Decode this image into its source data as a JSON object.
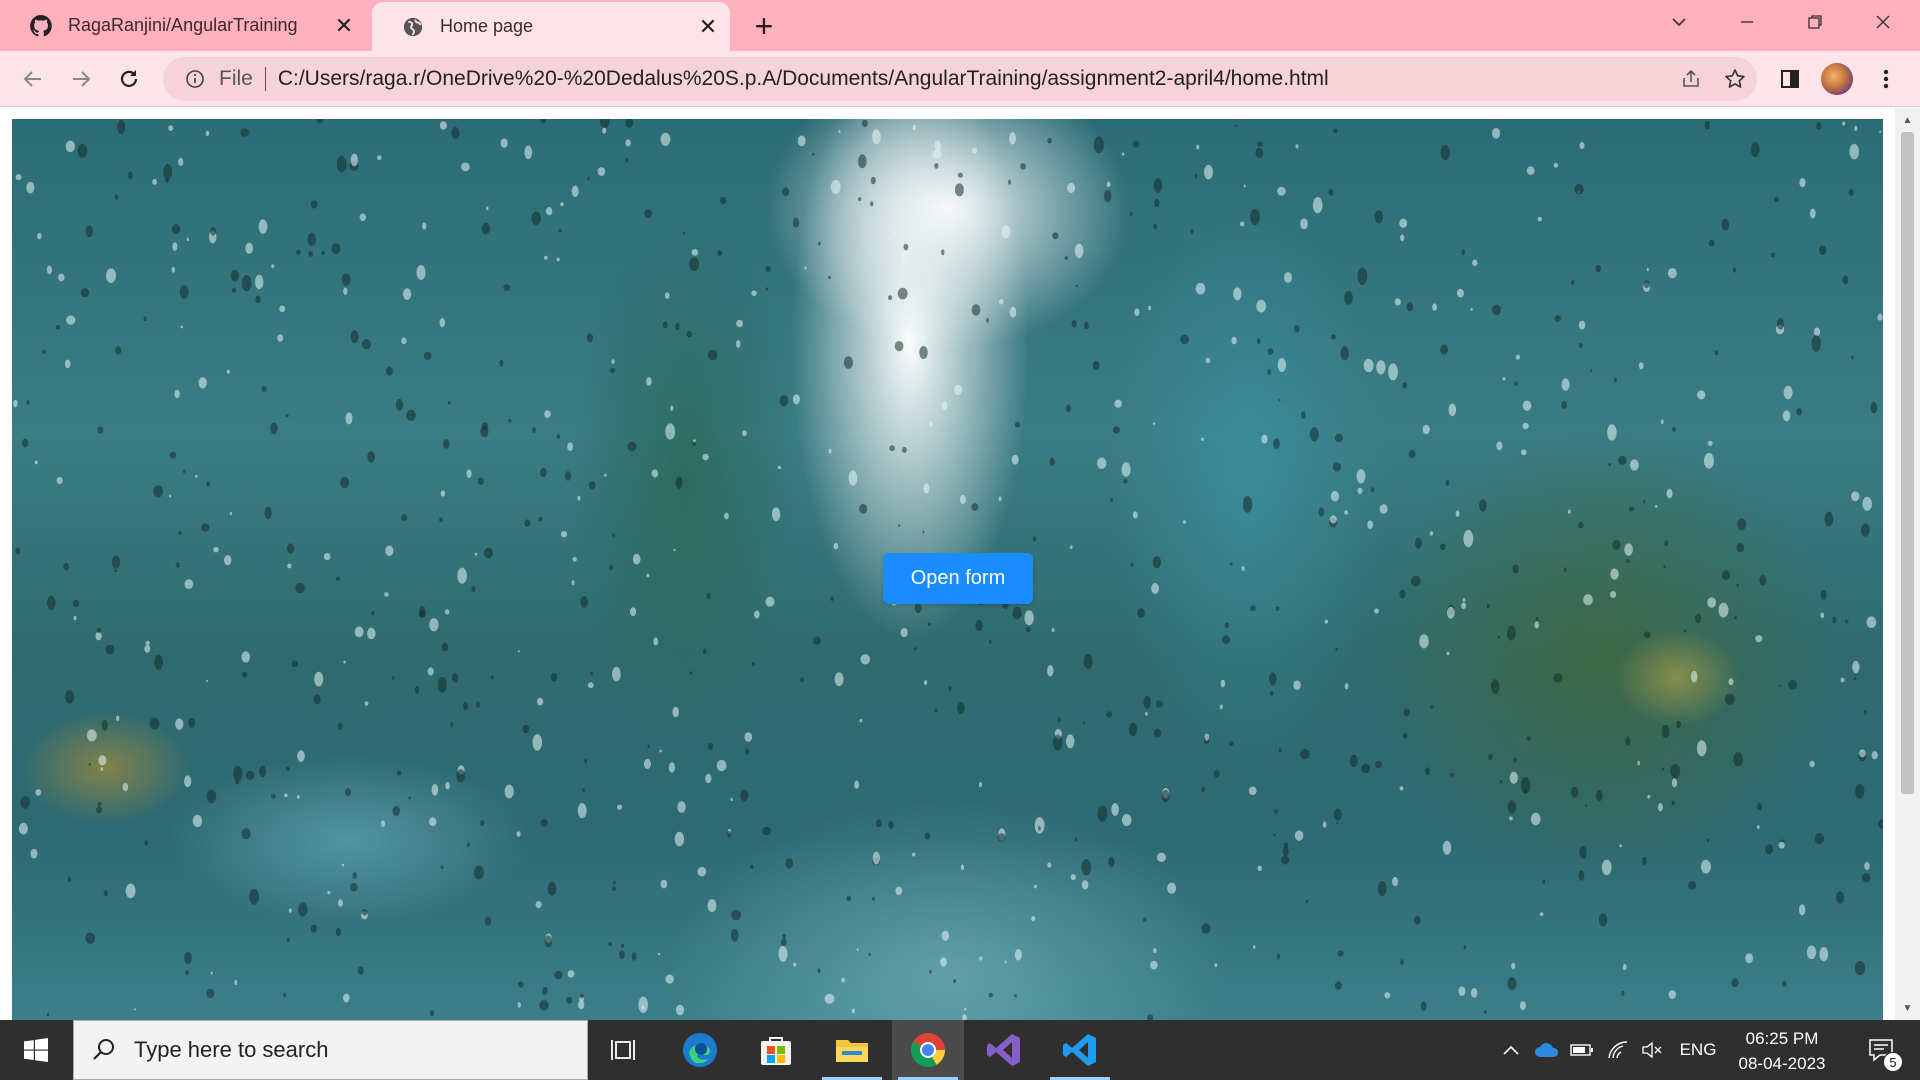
{
  "browser": {
    "tabs": [
      {
        "title": "RagaRanjini/AngularTraining",
        "icon": "github-icon",
        "active": false
      },
      {
        "title": "Home page",
        "icon": "globe-icon",
        "active": true
      }
    ],
    "omnibox": {
      "scheme_label": "File",
      "url": "C:/Users/raga.r/OneDrive%20-%20Dedalus%20S.p.A/Documents/AngularTraining/assignment2-april4/home.html"
    }
  },
  "page": {
    "open_form_label": "Open form",
    "accent_color": "#1a8cff"
  },
  "taskbar": {
    "search_placeholder": "Type here to search",
    "language": "ENG",
    "time": "06:25 PM",
    "date": "08-04-2023",
    "notification_count": "5",
    "apps": [
      "task-view-icon",
      "edge-icon",
      "store-icon",
      "file-explorer-icon",
      "chrome-icon",
      "visual-studio-icon",
      "vscode-icon"
    ]
  }
}
